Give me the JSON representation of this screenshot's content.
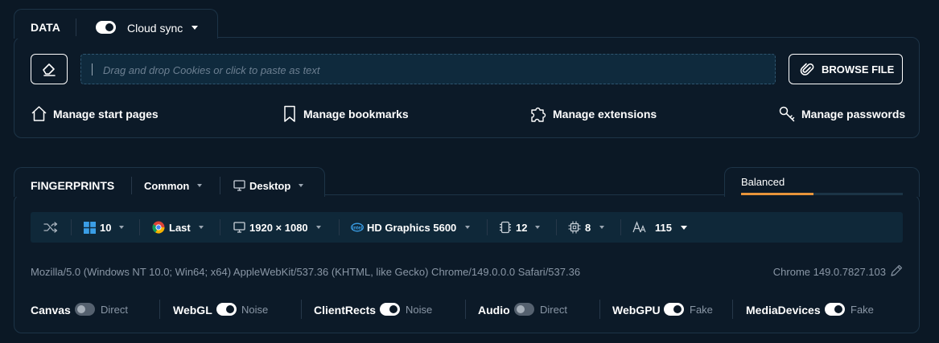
{
  "data_section": {
    "title": "DATA",
    "cloud_sync_label": "Cloud sync",
    "cloud_sync_on": true,
    "input_placeholder": "Drag and drop Cookies or click to paste as text",
    "browse_label": "BROWSE FILE",
    "actions": [
      {
        "label": "Manage start pages",
        "icon": "home-icon"
      },
      {
        "label": "Manage bookmarks",
        "icon": "bookmark-icon"
      },
      {
        "label": "Manage extensions",
        "icon": "puzzle-icon"
      },
      {
        "label": "Manage passwords",
        "icon": "key-icon"
      }
    ]
  },
  "fingerprints": {
    "title": "FINGERPRINTS",
    "profile_type": "Common",
    "device": "Desktop",
    "mode_tab": "Balanced",
    "accent_color": "#e8943a",
    "toolbar": {
      "os_version": "10",
      "browser_version": "Last",
      "resolution": "1920 × 1080",
      "gpu": "HD Graphics 5600",
      "cpu_cores": "12",
      "memory": "8",
      "fonts": "115"
    },
    "user_agent": "Mozilla/5.0 (Windows NT 10.0; Win64; x64) AppleWebKit/537.36 (KHTML, like Gecko) Chrome/149.0.0.0 Safari/537.36",
    "browser_label": "Chrome 149.0.7827.103",
    "toggles": [
      {
        "label": "Canvas",
        "on": false,
        "mode": "Direct"
      },
      {
        "label": "WebGL",
        "on": true,
        "mode": "Noise"
      },
      {
        "label": "ClientRects",
        "on": true,
        "mode": "Noise"
      },
      {
        "label": "Audio",
        "on": false,
        "mode": "Direct"
      },
      {
        "label": "WebGPU",
        "on": true,
        "mode": "Fake"
      },
      {
        "label": "MediaDevices",
        "on": true,
        "mode": "Fake"
      }
    ]
  }
}
